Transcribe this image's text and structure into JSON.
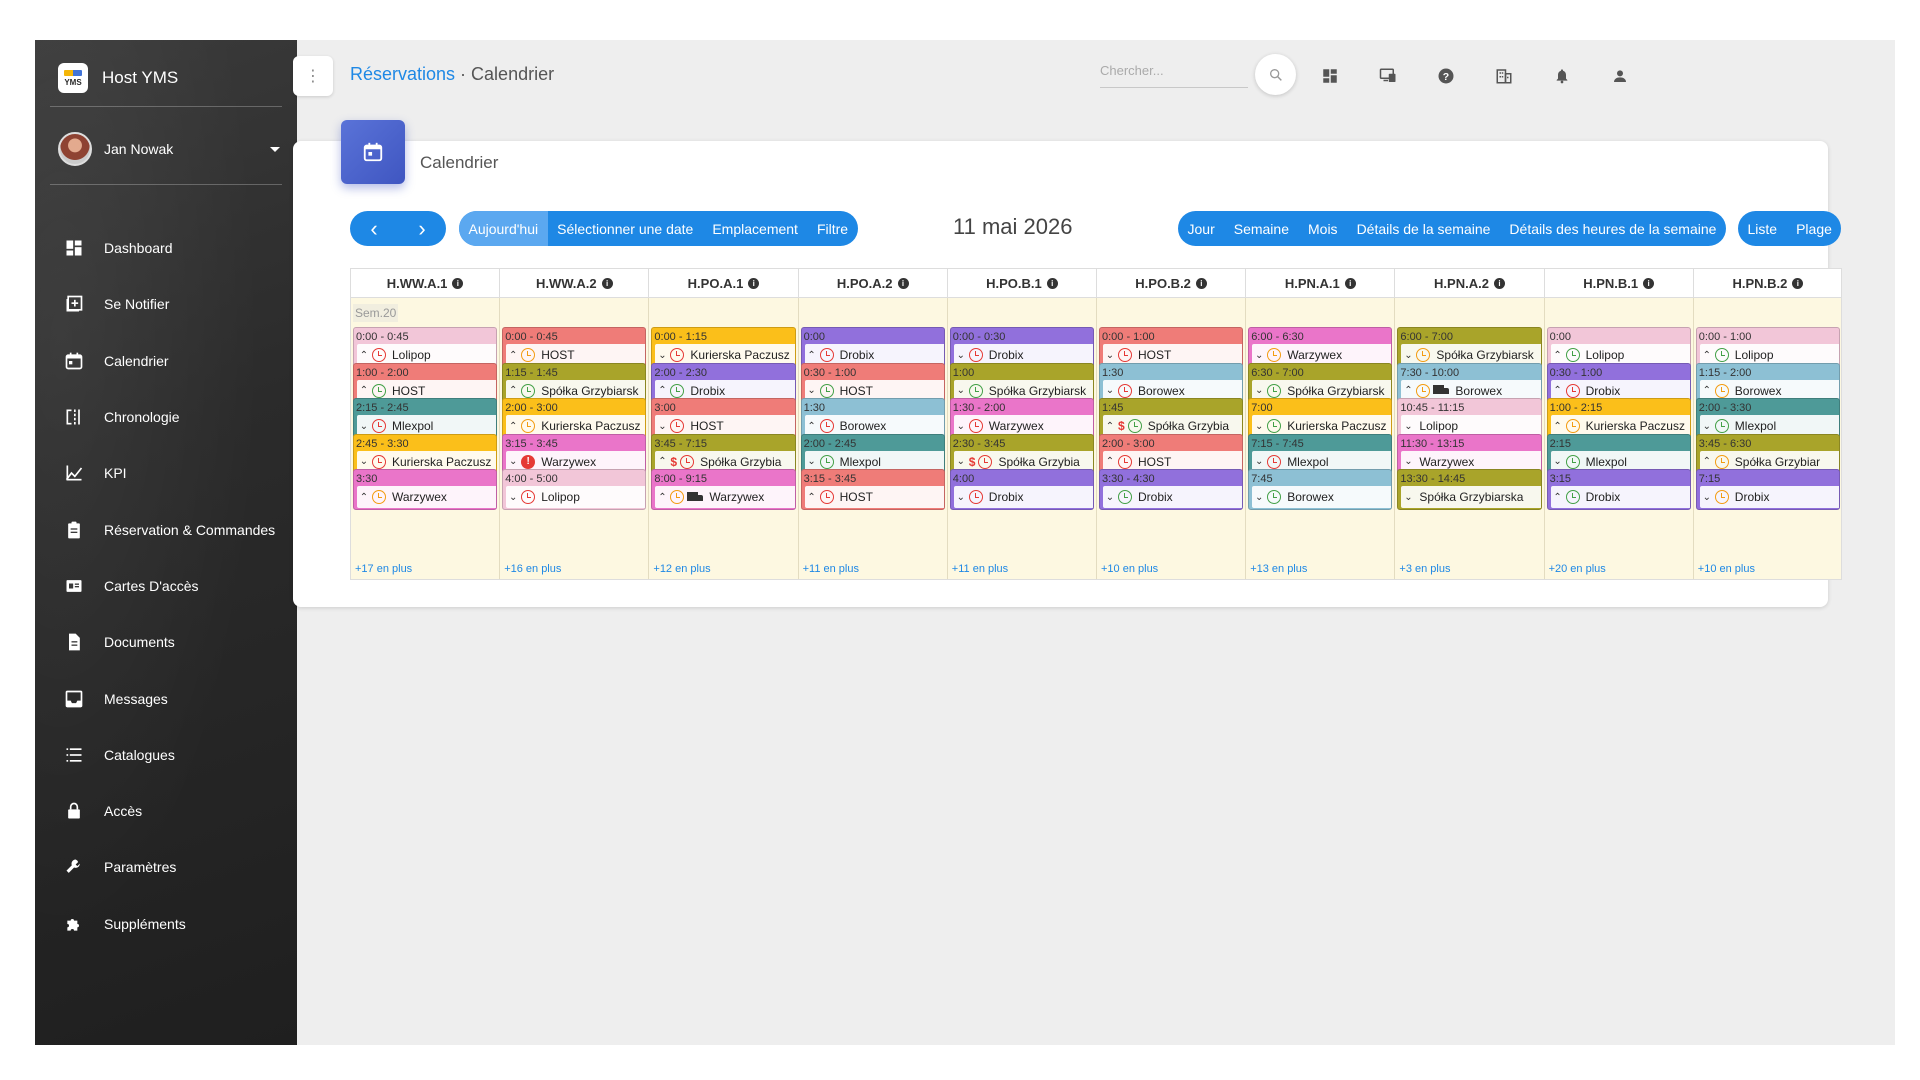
{
  "app": {
    "title": "Host YMS",
    "logo_text": "YMS"
  },
  "user": {
    "name": "Jan Nowak"
  },
  "sidebar": {
    "items": [
      {
        "label": "Dashboard",
        "icon": "dashboard-icon"
      },
      {
        "label": "Se Notifier",
        "icon": "add-box-icon"
      },
      {
        "label": "Calendrier",
        "icon": "calendar-icon"
      },
      {
        "label": "Chronologie",
        "icon": "timeline-icon"
      },
      {
        "label": "KPI",
        "icon": "kpi-chart-icon"
      },
      {
        "label": "Réservation & Commandes",
        "icon": "clipboard-icon"
      },
      {
        "label": "Cartes D'accès",
        "icon": "access-card-icon"
      },
      {
        "label": "Documents",
        "icon": "document-icon"
      },
      {
        "label": "Messages",
        "icon": "inbox-icon"
      },
      {
        "label": "Catalogues",
        "icon": "list-icon"
      },
      {
        "label": "Accès",
        "icon": "lock-icon"
      },
      {
        "label": "Paramètres",
        "icon": "wrench-icon"
      },
      {
        "label": "Suppléments",
        "icon": "puzzle-icon"
      }
    ]
  },
  "header": {
    "menu_icon": "more-vert-icon",
    "breadcrumb_link": "Réservations",
    "breadcrumb_sep": " · ",
    "breadcrumb_current": "Calendrier",
    "search_placeholder": "Chercher...",
    "icons": [
      "search-icon",
      "dashboard-icon",
      "monitor-icon",
      "help-icon",
      "building-icon",
      "bell-icon",
      "person-icon"
    ]
  },
  "card": {
    "title": "Calendrier",
    "icon": "calendar-icon",
    "date_title": "11 mai 2026",
    "nav_prev": "‹",
    "nav_next": "›",
    "toolbar_left": [
      "Aujourd'hui",
      "Sélectionner une date",
      "Emplacement",
      "Filtre"
    ],
    "view_buttons": [
      "Jour",
      "Semaine",
      "Mois",
      "Détails de la semaine",
      "Détails des heures de la semaine"
    ],
    "view_buttons_2": [
      "Liste",
      "Plage"
    ],
    "week_label": "Sem.20"
  },
  "colors": {
    "accent": "#1e88e5",
    "pink_light": "#f2c6d8",
    "salmon": "#ef7c78",
    "olive": "#a9a42a",
    "teal": "#4e9a98",
    "orange": "#fbbf1a",
    "magenta": "#ea75c9",
    "purple": "#9170dc",
    "sky": "#8dc0d4"
  },
  "columns": [
    {
      "name": "H.WW.A.1",
      "more": "+17 en plus",
      "events": [
        {
          "time": "0:00 - 0:45",
          "label": "Lolipop",
          "color": "#f2c6d8",
          "chev": "up",
          "icons": [
            "clock-red"
          ]
        },
        {
          "time": "1:00 - 2:00",
          "label": "HOST",
          "color": "#ef7c78",
          "chev": "up",
          "icons": [
            "clock-green"
          ]
        },
        {
          "time": "2:15 - 2:45",
          "label": "Mlexpol",
          "color": "#4e9a98",
          "chev": "down",
          "icons": [
            "clock-red"
          ]
        },
        {
          "time": "2:45 - 3:30",
          "label": "Kurierska Paczusz",
          "color": "#fbbf1a",
          "chev": "down",
          "icons": [
            "clock-red"
          ]
        },
        {
          "time": "3:30",
          "label": "Warzywex",
          "color": "#ea75c9",
          "chev": "up",
          "icons": [
            "clock-orange"
          ]
        }
      ]
    },
    {
      "name": "H.WW.A.2",
      "more": "+16 en plus",
      "events": [
        {
          "time": "0:00 - 0:45",
          "label": "HOST",
          "color": "#ef7c78",
          "chev": "up",
          "icons": [
            "clock-orange"
          ]
        },
        {
          "time": "1:15 - 1:45",
          "label": "Spółka Grzybiarsk",
          "color": "#a9a42a",
          "chev": "up",
          "icons": [
            "clock-green"
          ]
        },
        {
          "time": "2:00 - 3:00",
          "label": "Kurierska Paczusz",
          "color": "#fbbf1a",
          "chev": "up",
          "icons": [
            "clock-orange"
          ]
        },
        {
          "time": "3:15 - 3:45",
          "label": "Warzywex",
          "color": "#ea75c9",
          "chev": "down",
          "icons": [
            "alert"
          ]
        },
        {
          "time": "4:00 - 5:00",
          "label": "Lolipop",
          "color": "#f2c6d8",
          "chev": "down",
          "icons": [
            "clock-red"
          ]
        }
      ]
    },
    {
      "name": "H.PO.A.1",
      "more": "+12 en plus",
      "events": [
        {
          "time": "0:00 - 1:15",
          "label": "Kurierska Paczusz",
          "color": "#fbbf1a",
          "chev": "down",
          "icons": [
            "clock-red"
          ]
        },
        {
          "time": "2:00 - 2:30",
          "label": "Drobix",
          "color": "#9170dc",
          "chev": "up",
          "icons": [
            "clock-green"
          ]
        },
        {
          "time": "3:00",
          "label": "HOST",
          "color": "#ef7c78",
          "chev": "down",
          "icons": [
            "clock-red"
          ]
        },
        {
          "time": "3:45 - 7:15",
          "label": "Spółka Grzybia",
          "color": "#a9a42a",
          "chev": "up",
          "icons": [
            "dollar",
            "clock-red"
          ]
        },
        {
          "time": "8:00 - 9:15",
          "label": "Warzywex",
          "color": "#ea75c9",
          "chev": "up",
          "icons": [
            "clock-orange",
            "truck"
          ]
        }
      ]
    },
    {
      "name": "H.PO.A.2",
      "more": "+11 en plus",
      "events": [
        {
          "time": "0:00",
          "label": "Drobix",
          "color": "#9170dc",
          "chev": "up",
          "icons": [
            "clock-red"
          ]
        },
        {
          "time": "0:30 - 1:00",
          "label": "HOST",
          "color": "#ef7c78",
          "chev": "down",
          "icons": [
            "clock-green"
          ]
        },
        {
          "time": "1:30",
          "label": "Borowex",
          "color": "#8dc0d4",
          "chev": "up",
          "icons": [
            "clock-red"
          ]
        },
        {
          "time": "2:00 - 2:45",
          "label": "Mlexpol",
          "color": "#4e9a98",
          "chev": "down",
          "icons": [
            "clock-green"
          ]
        },
        {
          "time": "3:15 - 3:45",
          "label": "HOST",
          "color": "#ef7c78",
          "chev": "up",
          "icons": [
            "clock-red"
          ]
        }
      ]
    },
    {
      "name": "H.PO.B.1",
      "more": "+11 en plus",
      "events": [
        {
          "time": "0:00 - 0:30",
          "label": "Drobix",
          "color": "#9170dc",
          "chev": "down",
          "icons": [
            "clock-red"
          ]
        },
        {
          "time": "1:00",
          "label": "Spółka Grzybiarsk",
          "color": "#a9a42a",
          "chev": "down",
          "icons": [
            "clock-green"
          ]
        },
        {
          "time": "1:30 - 2:00",
          "label": "Warzywex",
          "color": "#ea75c9",
          "chev": "down",
          "icons": [
            "clock-red"
          ]
        },
        {
          "time": "2:30 - 3:45",
          "label": "Spółka Grzybia",
          "color": "#a9a42a",
          "chev": "down",
          "icons": [
            "dollar",
            "clock-red"
          ]
        },
        {
          "time": "4:00",
          "label": "Drobix",
          "color": "#9170dc",
          "chev": "down",
          "icons": [
            "clock-red"
          ]
        }
      ]
    },
    {
      "name": "H.PO.B.2",
      "more": "+10 en plus",
      "events": [
        {
          "time": "0:00 - 1:00",
          "label": "HOST",
          "color": "#ef7c78",
          "chev": "down",
          "icons": [
            "clock-red"
          ]
        },
        {
          "time": "1:30",
          "label": "Borowex",
          "color": "#8dc0d4",
          "chev": "down",
          "icons": [
            "clock-red"
          ]
        },
        {
          "time": "1:45",
          "label": "Spółka Grzybia",
          "color": "#a9a42a",
          "chev": "up",
          "icons": [
            "dollar",
            "clock-green"
          ]
        },
        {
          "time": "2:00 - 3:00",
          "label": "HOST",
          "color": "#ef7c78",
          "chev": "up",
          "icons": [
            "clock-red"
          ]
        },
        {
          "time": "3:30 - 4:30",
          "label": "Drobix",
          "color": "#9170dc",
          "chev": "down",
          "icons": [
            "clock-green"
          ]
        }
      ]
    },
    {
      "name": "H.PN.A.1",
      "more": "+13 en plus",
      "events": [
        {
          "time": "6:00 - 6:30",
          "label": "Warzywex",
          "color": "#ea75c9",
          "chev": "down",
          "icons": [
            "clock-orange"
          ]
        },
        {
          "time": "6:30 - 7:00",
          "label": "Spółka Grzybiarsk",
          "color": "#a9a42a",
          "chev": "down",
          "icons": [
            "clock-green"
          ]
        },
        {
          "time": "7:00",
          "label": "Kurierska Paczusz",
          "color": "#fbbf1a",
          "chev": "down",
          "icons": [
            "clock-green"
          ]
        },
        {
          "time": "7:15 - 7:45",
          "label": "Mlexpol",
          "color": "#4e9a98",
          "chev": "down",
          "icons": [
            "clock-red"
          ]
        },
        {
          "time": "7:45",
          "label": "Borowex",
          "color": "#8dc0d4",
          "chev": "down",
          "icons": [
            "clock-green"
          ]
        }
      ]
    },
    {
      "name": "H.PN.A.2",
      "more": "+3 en plus",
      "events": [
        {
          "time": "6:00 - 7:00",
          "label": "Spółka Grzybiarsk",
          "color": "#a9a42a",
          "chev": "down",
          "icons": [
            "clock-orange"
          ]
        },
        {
          "time": "7:30 - 10:00",
          "label": "Borowex",
          "color": "#8dc0d4",
          "chev": "up",
          "icons": [
            "clock-orange",
            "truck"
          ]
        },
        {
          "time": "10:45 - 11:15",
          "label": "Lolipop",
          "color": "#f2c6d8",
          "chev": "down",
          "icons": []
        },
        {
          "time": "11:30 - 13:15",
          "label": "Warzywex",
          "color": "#ea75c9",
          "chev": "down",
          "icons": []
        },
        {
          "time": "13:30 - 14:45",
          "label": "Spółka Grzybiarska",
          "color": "#a9a42a",
          "chev": "down",
          "icons": []
        }
      ]
    },
    {
      "name": "H.PN.B.1",
      "more": "+20 en plus",
      "events": [
        {
          "time": "0:00",
          "label": "Lolipop",
          "color": "#f2c6d8",
          "chev": "up",
          "icons": [
            "clock-green"
          ]
        },
        {
          "time": "0:30 - 1:00",
          "label": "Drobix",
          "color": "#9170dc",
          "chev": "up",
          "icons": [
            "clock-red"
          ]
        },
        {
          "time": "1:00 - 2:15",
          "label": "Kurierska Paczusz",
          "color": "#fbbf1a",
          "chev": "up",
          "icons": [
            "clock-orange"
          ]
        },
        {
          "time": "2:15",
          "label": "Mlexpol",
          "color": "#4e9a98",
          "chev": "down",
          "icons": [
            "clock-green"
          ]
        },
        {
          "time": "3:15",
          "label": "Drobix",
          "color": "#9170dc",
          "chev": "up",
          "icons": [
            "clock-green"
          ]
        }
      ]
    },
    {
      "name": "H.PN.B.2",
      "more": "+10 en plus",
      "events": [
        {
          "time": "0:00 - 1:00",
          "label": "Lolipop",
          "color": "#f2c6d8",
          "chev": "up",
          "icons": [
            "clock-green"
          ]
        },
        {
          "time": "1:15 - 2:00",
          "label": "Borowex",
          "color": "#8dc0d4",
          "chev": "up",
          "icons": [
            "clock-orange"
          ]
        },
        {
          "time": "2:00 - 3:30",
          "label": "Mlexpol",
          "color": "#4e9a98",
          "chev": "down",
          "icons": [
            "clock-green"
          ]
        },
        {
          "time": "3:45 - 6:30",
          "label": "Spółka Grzybiar",
          "color": "#a9a42a",
          "chev": "up",
          "icons": [
            "clock-orange"
          ]
        },
        {
          "time": "7:15",
          "label": "Drobix",
          "color": "#9170dc",
          "chev": "down",
          "icons": [
            "clock-orange"
          ]
        }
      ]
    }
  ]
}
